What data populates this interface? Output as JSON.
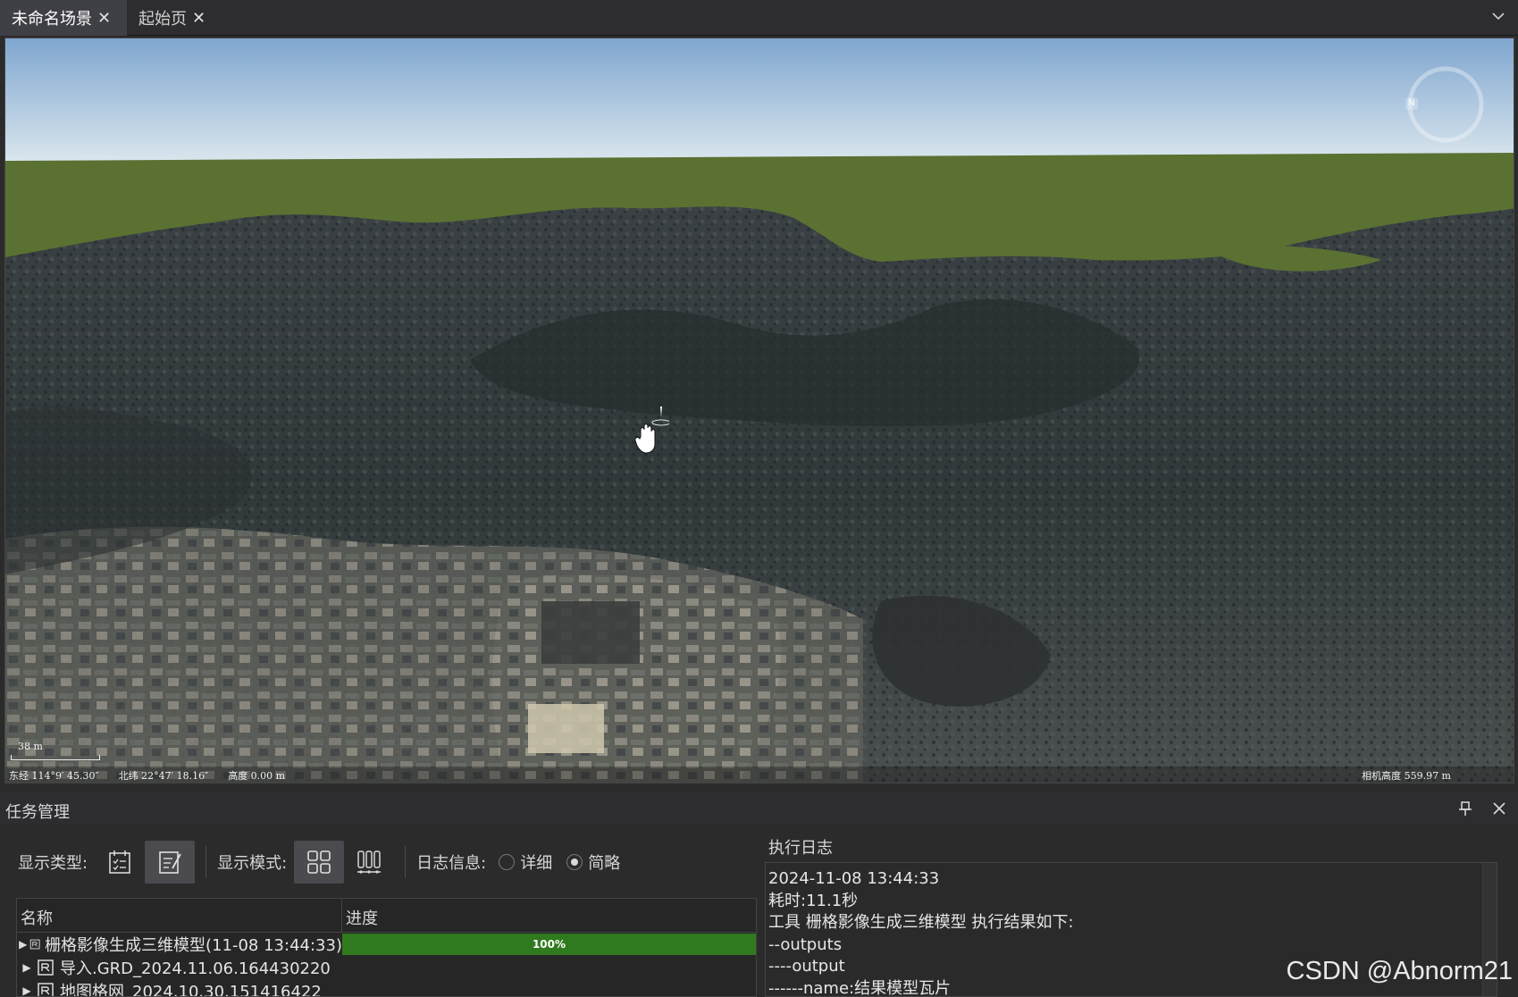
{
  "tabs": [
    {
      "label": "未命名场景",
      "active": true
    },
    {
      "label": "起始页",
      "active": false
    }
  ],
  "viewport": {
    "scale_label": "38 m",
    "longitude": "东经 114°9′ 45.30″",
    "latitude": "北纬 22°47′ 18.16″",
    "altitude": "高度 0.00 m",
    "camera_height": "相机高度 559.97 m",
    "compass_letter": "N"
  },
  "panel": {
    "title": "任务管理",
    "toolbar": {
      "display_type_label": "显示类型:",
      "display_mode_label": "显示模式:",
      "log_info_label": "日志信息:",
      "radio_detailed": "详细",
      "radio_brief": "简略",
      "selected_radio": "简略"
    },
    "grid": {
      "headers": {
        "name": "名称",
        "progress": "进度"
      },
      "rows": [
        {
          "name": "栅格影像生成三维模型(11-08 13:44:33)",
          "progress": 100,
          "progress_text": "100%"
        },
        {
          "name": "导入.GRD_2024.11.06.164430220",
          "progress": null,
          "progress_text": ""
        },
        {
          "name": "地图格网_2024.10.30.151416422",
          "progress": null,
          "progress_text": ""
        }
      ]
    },
    "log": {
      "title": "执行日志",
      "lines": [
        "2024-11-08 13:44:33",
        "耗时:11.1秒",
        "工具 栅格影像生成三维模型 执行结果如下:",
        "--outputs",
        "----output",
        "------name:结果模型瓦片"
      ]
    }
  },
  "watermark": "CSDN @Abnorm21",
  "colors": {
    "progress": "#2f7a1e",
    "sky_top": "#7fa6cf",
    "ground_plane": "#5a7132"
  }
}
